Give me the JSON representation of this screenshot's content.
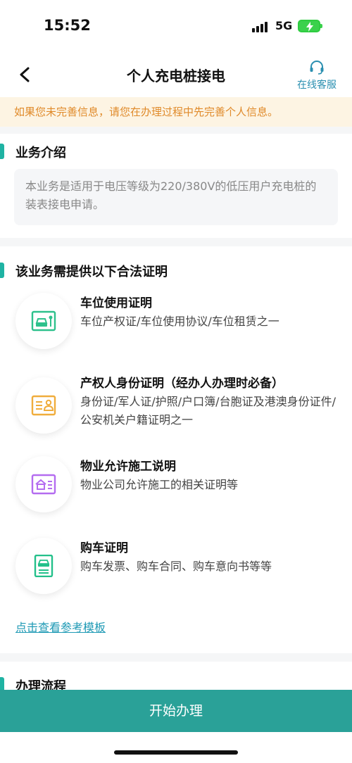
{
  "status": {
    "time": "15:52",
    "network": "5G"
  },
  "nav": {
    "title": "个人充电桩接电",
    "service_label": "在线客服"
  },
  "notice": "如果您未完善信息，请您在办理过程中先完善个人信息。",
  "intro": {
    "heading": "业务介绍",
    "text": "本业务是适用于电压等级为220/380V的低压用户充电桩的装表接电申请。"
  },
  "docs": {
    "heading": "该业务需提供以下合法证明",
    "items": [
      {
        "title": "车位使用证明",
        "desc": "车位产权证/车位使用协议/车位租赁之一",
        "icon": "parking-card-icon",
        "color": "#2ec18c"
      },
      {
        "title": "产权人身份证明（经办人办理时必备）",
        "desc": "身份证/军人证/护照/户口簿/台胞证及港澳身份证件/公安机关户籍证明之一",
        "icon": "id-card-icon",
        "color": "#f0ad3c"
      },
      {
        "title": "物业允许施工说明",
        "desc": "物业公司允许施工的相关证明等",
        "icon": "property-card-icon",
        "color": "#b46cf0"
      },
      {
        "title": "购车证明",
        "desc": "购车发票、购车合同、购车意向书等等",
        "icon": "car-document-icon",
        "color": "#23c08a"
      }
    ],
    "template_link": "点击查看参考模板"
  },
  "process": {
    "heading": "办理流程"
  },
  "start_button": "开始办理"
}
